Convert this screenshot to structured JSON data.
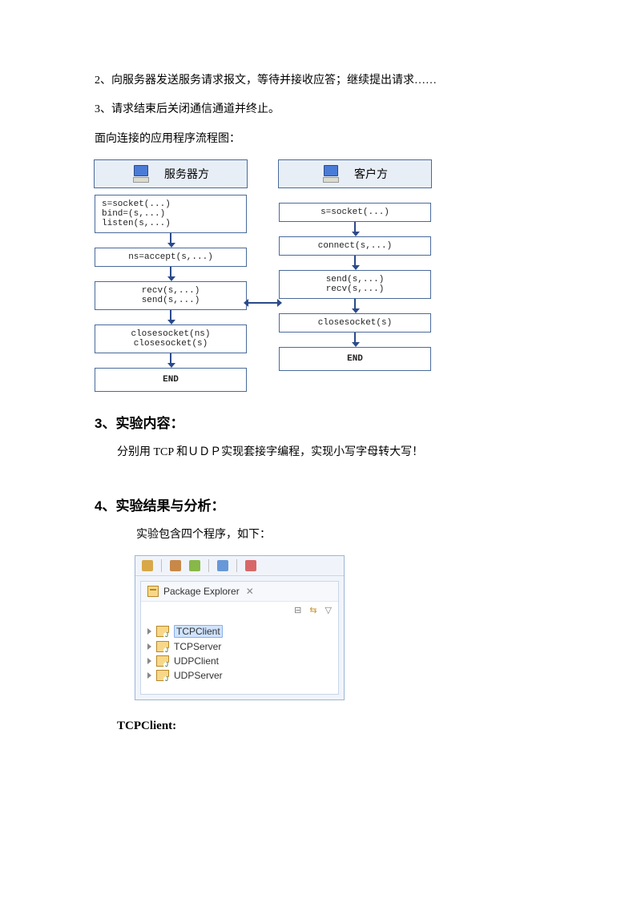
{
  "text": {
    "p1": "2、向服务器发送服务请求报文，等待并接收应答；继续提出请求……",
    "p2": "3、请求结束后关闭通信通道并终止。",
    "p3": "面向连接的应用程序流程图：",
    "section3": "3、实验内容：",
    "section3_body": "分别用 TCP 和ＵＤＰ实现套接字编程，实现小写字母转大写！",
    "section4": "4、实验结果与分析：",
    "section4_body": "实验包含四个程序，如下：",
    "tcpclient_label": "TCPClient:"
  },
  "diagram": {
    "server_title": "服务器方",
    "client_title": "客户方",
    "server": {
      "box1": "s=socket(...)\nbind=(s,...)\nlisten(s,...)",
      "box2": "ns=accept(s,...)",
      "box3": "recv(s,...)\nsend(s,...)",
      "box4": "closesocket(ns)\nclosesocket(s)",
      "end": "END"
    },
    "client": {
      "box1": "s=socket(...)",
      "box2": "connect(s,...)",
      "box3": "send(s,...)\nrecv(s,...)",
      "box4": "closesocket(s)",
      "end": "END"
    }
  },
  "ide": {
    "tab_title": "Package Explorer",
    "items": [
      "TCPClient",
      "TCPServer",
      "UDPClient",
      "UDPServer"
    ],
    "collapse_glyph": "⊟",
    "link_glyph": "⇆",
    "menu_glyph": "▽"
  }
}
